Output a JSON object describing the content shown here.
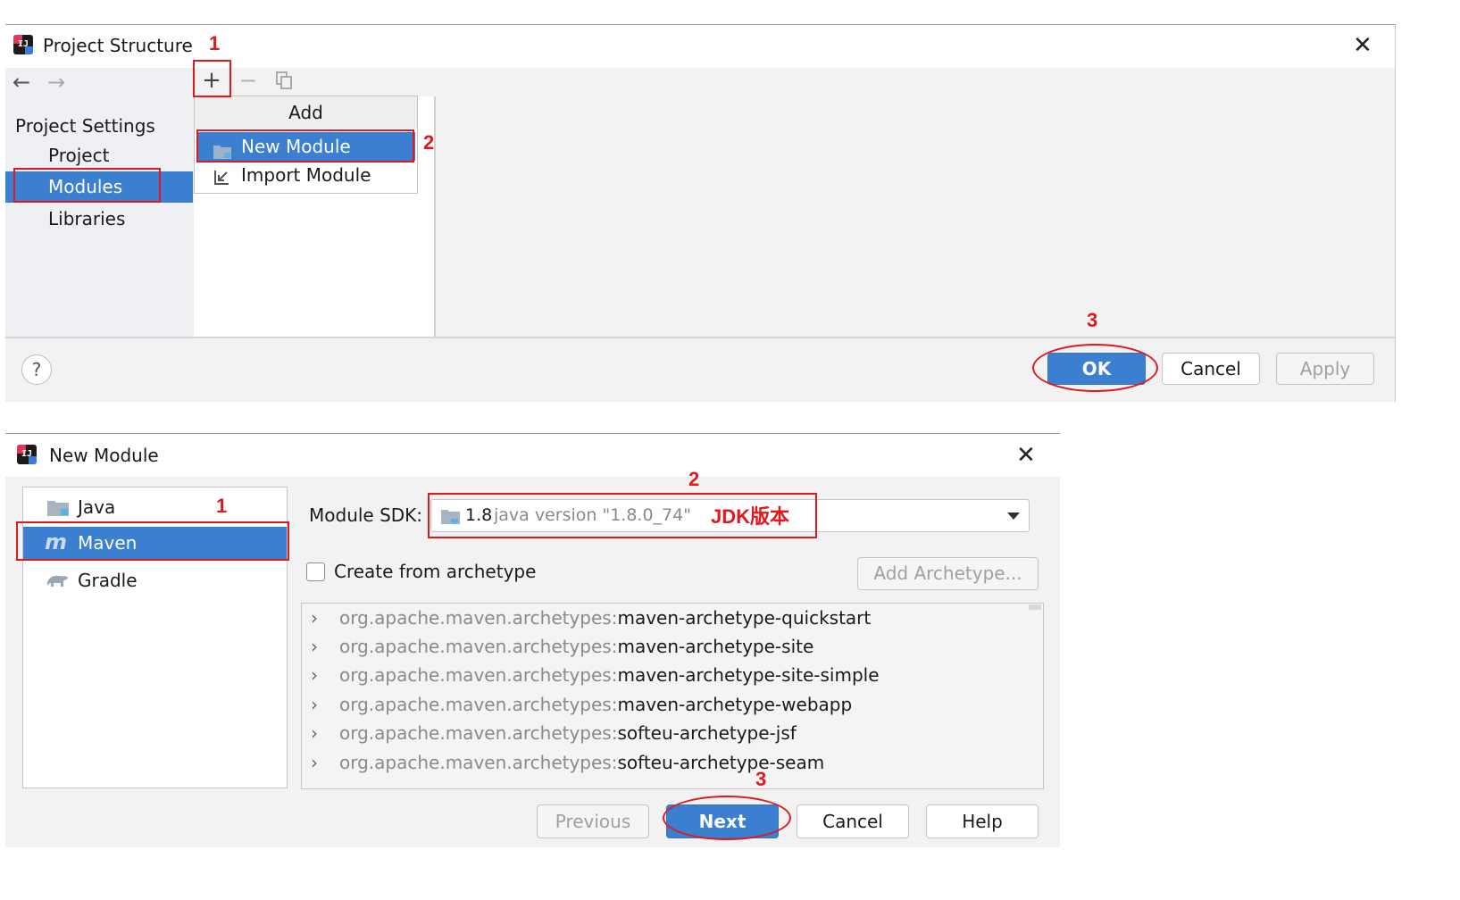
{
  "project_structure": {
    "title": "Project Structure",
    "nav_back_icon": "arrow-left-icon",
    "nav_forward_icon": "arrow-right-icon",
    "sidebar": {
      "section_title": "Project Settings",
      "items": [
        {
          "label": "Project"
        },
        {
          "label": "Modules",
          "selected": true
        },
        {
          "label": "Libraries"
        }
      ]
    },
    "toolbar": {
      "add_symbol": "+",
      "remove_symbol": "−"
    },
    "add_popup": {
      "header": "Add",
      "items": [
        {
          "label": "New Module",
          "icon": "folder-module-icon",
          "selected": true
        },
        {
          "label": "Import Module",
          "icon": "import-arrow-icon"
        }
      ]
    },
    "buttons": {
      "ok": "OK",
      "cancel": "Cancel",
      "apply": "Apply",
      "help_symbol": "?"
    },
    "annotations": {
      "step1": "1",
      "step2": "2",
      "step3": "3"
    }
  },
  "new_module": {
    "title": "New Module",
    "types": [
      {
        "label": "Java",
        "icon": "folder-icon"
      },
      {
        "label": "Maven",
        "icon": "maven-m-icon",
        "selected": true
      },
      {
        "label": "Gradle",
        "icon": "gradle-elephant-icon"
      }
    ],
    "sdk": {
      "label": "Module SDK:",
      "version": "1.8",
      "detail": "java version \"1.8.0_74\"",
      "note": "JDK版本"
    },
    "create_from_archetype": {
      "label": "Create from archetype",
      "checked": false
    },
    "add_archetype_button": "Add Archetype...",
    "archetypes": [
      {
        "group": "org.apache.maven.archetypes:",
        "artifact": "maven-archetype-quickstart"
      },
      {
        "group": "org.apache.maven.archetypes:",
        "artifact": "maven-archetype-site"
      },
      {
        "group": "org.apache.maven.archetypes:",
        "artifact": "maven-archetype-site-simple"
      },
      {
        "group": "org.apache.maven.archetypes:",
        "artifact": "maven-archetype-webapp"
      },
      {
        "group": "org.apache.maven.archetypes:",
        "artifact": "softeu-archetype-jsf"
      },
      {
        "group": "org.apache.maven.archetypes:",
        "artifact": "softeu-archetype-seam"
      }
    ],
    "buttons": {
      "previous": "Previous",
      "next": "Next",
      "cancel": "Cancel",
      "help": "Help"
    },
    "annotations": {
      "step1": "1",
      "step2": "2",
      "step3": "3"
    }
  },
  "colors": {
    "selection": "#3a7fd0",
    "annotation": "#e0191f",
    "dialog_bg": "#f2f2f2"
  }
}
